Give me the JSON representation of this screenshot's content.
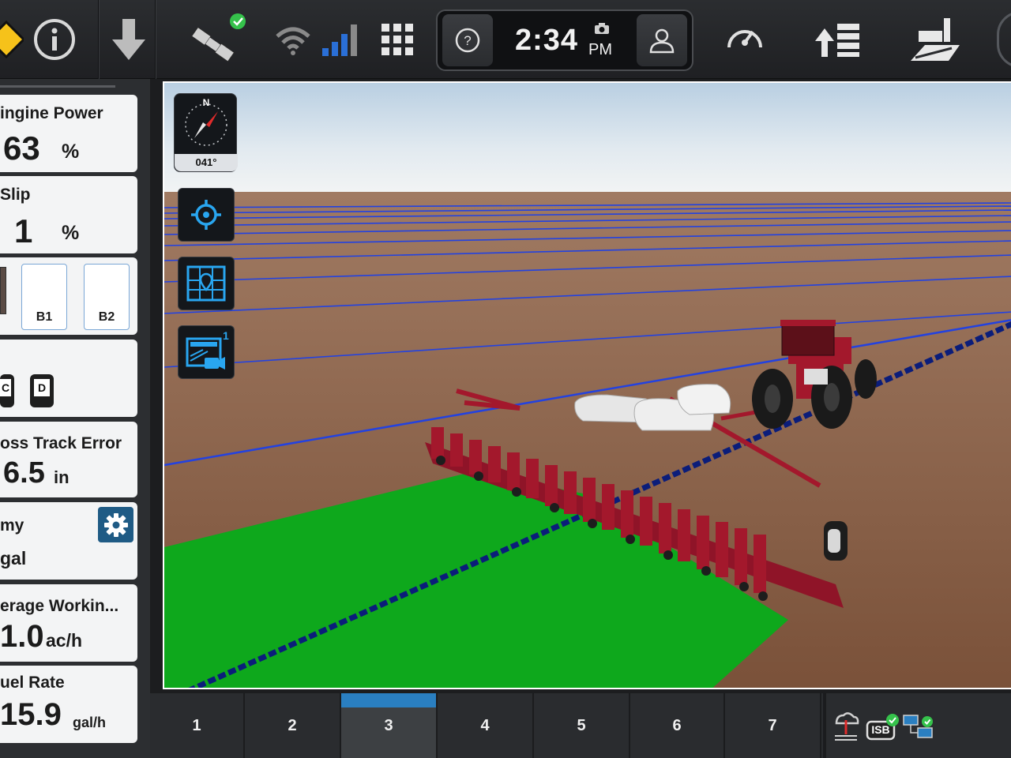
{
  "header": {
    "time": "2:34",
    "ampm": "PM",
    "icons": {
      "warning": "warning-icon",
      "info": "info-icon",
      "download": "download-arrow-icon",
      "gps": "satellite-gps-icon",
      "wifi": "wifi-icon",
      "cell": "cell-signal-icon",
      "apps": "app-grid-icon",
      "help": "help-icon",
      "camera": "camera-icon",
      "user": "user-icon",
      "gauge": "gauge-icon",
      "ranking": "priority-list-icon",
      "farm": "farm-field-icon"
    }
  },
  "left_panel": {
    "engine_power": {
      "title": "ingine Power",
      "value": "63",
      "unit": "%"
    },
    "slip": {
      "title": "Slip",
      "value": "1",
      "unit": "%"
    },
    "sections": {
      "b1": "B1",
      "b2": "B2"
    },
    "counters": {
      "c": "C",
      "d": "D"
    },
    "cross_track": {
      "title": "oss Track Error",
      "value": "6.5",
      "unit": "in"
    },
    "economy": {
      "title": "my",
      "value": "gal"
    },
    "avg_working": {
      "title": "erage Workin...",
      "value": "1.0",
      "unit": "ac/h"
    },
    "fuel_rate": {
      "title": "uel Rate",
      "value": "15.9",
      "unit": "gal/h"
    }
  },
  "map": {
    "compass_label": "N",
    "heading": "041°",
    "camera_count": "1",
    "colors": {
      "sky": "#e8eef3",
      "soil": "#8a5e45",
      "coverage": "#0ea81c",
      "guidance": "#1f3ad6",
      "implement": "#a3182c"
    }
  },
  "bottom_tabs": [
    {
      "label": "1"
    },
    {
      "label": "2"
    },
    {
      "label": "3"
    },
    {
      "label": "4"
    },
    {
      "label": "5"
    },
    {
      "label": "6"
    },
    {
      "label": "7"
    }
  ],
  "status_icons": [
    "weather-station-icon",
    "isobus-icon",
    "network-connection-icon"
  ],
  "status_text": {
    "isb": "ISB"
  }
}
